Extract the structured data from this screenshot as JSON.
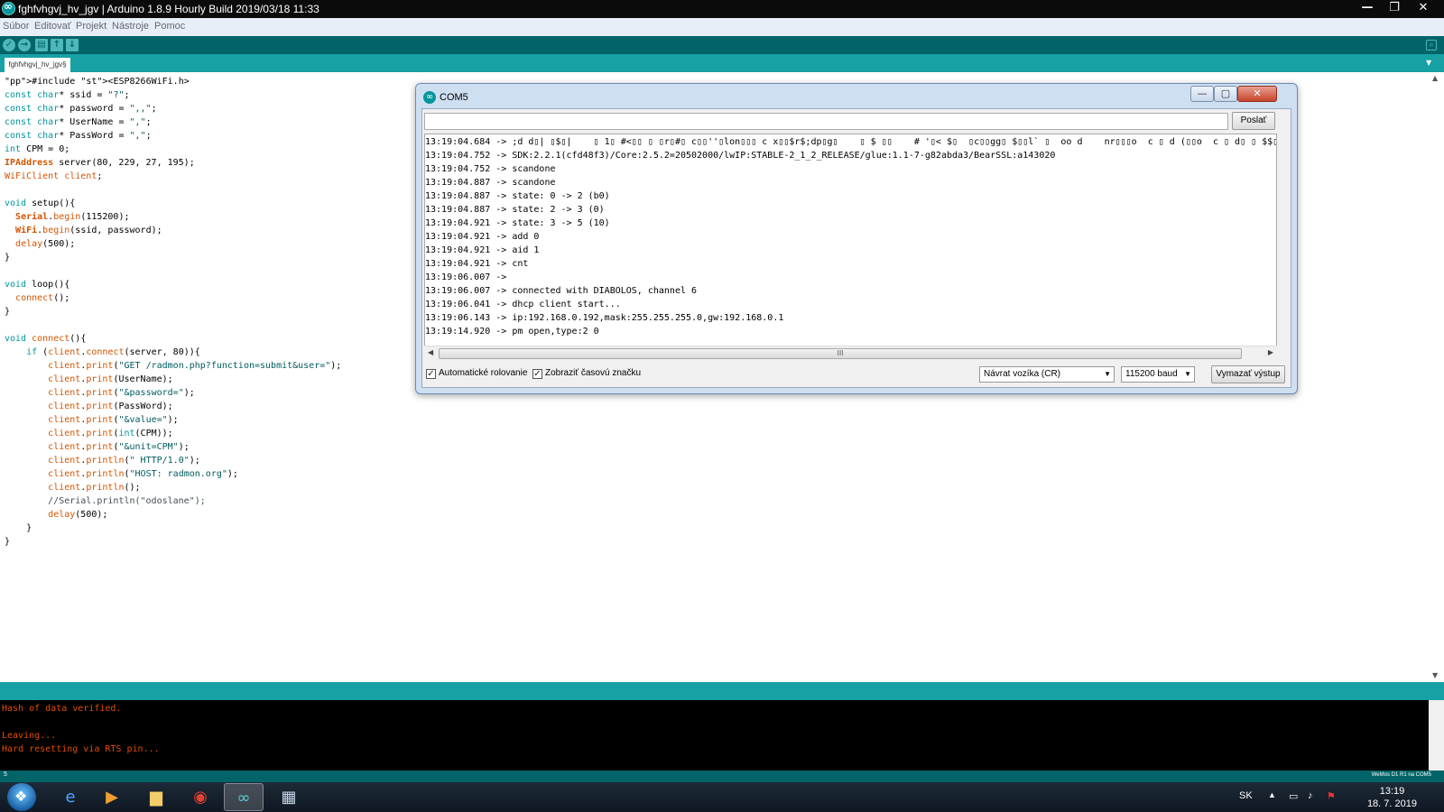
{
  "window": {
    "title": "fghfvhgvj_hv_jgv | Arduino 1.8.9 Hourly Build 2019/03/18 11:33",
    "controls": [
      "—",
      "❐",
      "✕"
    ]
  },
  "menu": [
    "Súbor",
    "Editovať",
    "Projekt",
    "Nástroje",
    "Pomoc"
  ],
  "toolbar": {
    "verify": "✓",
    "upload": "→",
    "new": "▤",
    "open": "↑",
    "save": "↓",
    "serial_monitor": "⌕"
  },
  "tab": {
    "name": "fghfvhgvj_hv_jgv§",
    "menu_glyph": "▼"
  },
  "code_lines": [
    "#include <ESP8266WiFi.h>",
    "const char* ssid = \"?\";",
    "const char* password = \",,\";",
    "const char* UserName = \",\";",
    "const char* PassWord = \",\";",
    "int CPM = 0;",
    "IPAddress server(80, 229, 27, 195);",
    "WiFiClient client;",
    "",
    "void setup(){",
    "  Serial.begin(115200);",
    "  WiFi.begin(ssid, password);",
    "  delay(500);",
    "}",
    "",
    "void loop(){",
    "  connect();",
    "}",
    "",
    "void connect(){",
    "    if (client.connect(server, 80)){",
    "        client.print(\"GET /radmon.php?function=submit&user=\");",
    "        client.print(UserName);",
    "        client.print(\"&password=\");",
    "        client.print(PassWord);",
    "        client.print(\"&value=\");",
    "        client.print(int(CPM));",
    "        client.print(\"&unit=CPM\");",
    "        client.println(\" HTTP/1.0\");",
    "        client.println(\"HOST: radmon.org\");",
    "        client.println();",
    "        //Serial.println(\"odoslane\");",
    "        delay(500);",
    "    }",
    "}"
  ],
  "console": {
    "lines": [
      "Hash of data verified.",
      "",
      "Leaving...",
      "Hard resetting via RTS pin..."
    ]
  },
  "status": {
    "line_number": "5",
    "board": "WeMos D1 R1 na COM5"
  },
  "serial_monitor": {
    "title": "COM5",
    "send_label": "Poslať",
    "input_value": "",
    "output_lines": [
      "13:19:04.684 -> ;d d▯| ▯$▯|    ▯ 1▯ #<▯▯ ▯ ▯r▯#▯ c▯▯''▯lon▯▯▯ c x▯▯$r$;dp▯g▯    ▯ $ ▯▯    # '▯< $▯  ▯c▯▯gg▯ $▯▯l` ▯  oo d    nr▯▯▯o  c ▯ d (▯▯o  c ▯ d▯ ▯ $$▯ ▯$",
      "13:19:04.752 -> SDK:2.2.1(cfd48f3)/Core:2.5.2=20502000/lwIP:STABLE-2_1_2_RELEASE/glue:1.1-7-g82abda3/BearSSL:a143020",
      "13:19:04.752 -> scandone",
      "13:19:04.887 -> scandone",
      "13:19:04.887 -> state: 0 -> 2 (b0)",
      "13:19:04.887 -> state: 2 -> 3 (0)",
      "13:19:04.921 -> state: 3 -> 5 (10)",
      "13:19:04.921 -> add 0",
      "13:19:04.921 -> aid 1",
      "13:19:04.921 -> cnt",
      "13:19:06.007 -> ",
      "13:19:06.007 -> connected with DIABOLOS, channel 6",
      "13:19:06.041 -> dhcp client start...",
      "13:19:06.143 -> ip:192.168.0.192,mask:255.255.255.0,gw:192.168.0.1",
      "13:19:14.920 -> pm open,type:2 0"
    ],
    "autoscroll_label": "Automatické rolovanie",
    "autoscroll_checked": true,
    "timestamp_label": "Zobraziť časovú značku",
    "timestamp_checked": true,
    "line_ending": "Návrat vozíka (CR)",
    "baud": "115200 baud",
    "clear_label": "Vymazať výstup",
    "hscroll_grip": "III"
  },
  "taskbar": {
    "apps": [
      "ie-icon",
      "media-player-icon",
      "file-explorer-icon",
      "chrome-icon",
      "arduino-icon",
      "calculator-icon"
    ],
    "language": "SK",
    "time": "13:19",
    "date": "18. 7. 2019"
  }
}
